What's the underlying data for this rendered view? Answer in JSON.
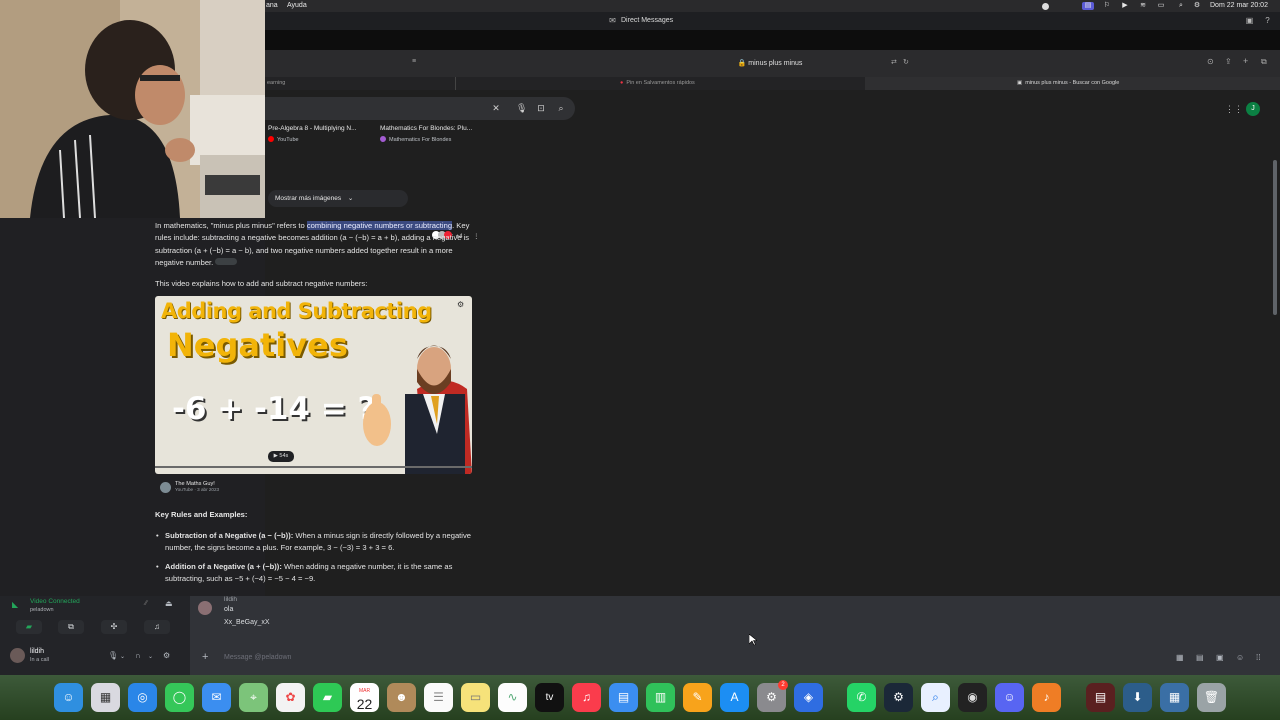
{
  "menubar": {
    "left_items": [
      "ana",
      "Ayuda"
    ],
    "datetime": "Dom 22 mar  20:02"
  },
  "discord": {
    "window_title": "Direct Messages",
    "voice": {
      "status": "Video Connected",
      "channel": "peladown"
    },
    "user": {
      "name": "lildih",
      "status": "In a call"
    },
    "messages": {
      "author": "lildih",
      "lines": [
        "ola",
        "Xx_BeGay_xX"
      ],
      "input_placeholder": "Message @peladown"
    }
  },
  "browser": {
    "url": "minus plus minus",
    "tabs": [
      "earning",
      "Pin en Salvamentos rápidos",
      "minus plus minus - Buscar con Google"
    ],
    "avatar_letter": "J",
    "video_cards": [
      {
        "title": "Pre-Algebra 8 - Multiplying N...",
        "source": "YouTube"
      },
      {
        "title": "Mathematics For Blondes: Plu...",
        "source": "Mathematics For Blondes"
      }
    ],
    "more_images": "Mostrar más imágenes",
    "source_count": "+4",
    "overview": {
      "p1_before": "In mathematics, \"minus plus minus\" refers to ",
      "p1_highlight": "combining negative numbers or subtracting",
      "p1_after": ". Key rules include: subtracting a negative becomes addition (a − (−b) = a + b), adding a negative is subtraction (a + (−b) = a − b), and two negative numbers added together result in a more negative number."
    },
    "video_intro": "This video explains how to add and subtract negative numbers:",
    "video": {
      "line1": "Adding and Subtracting",
      "line2": "Negatives",
      "equation": "-6 + -14 = ?",
      "duration": "▶ 54s",
      "channel": "The Maths Guy!",
      "channel_sub": "YouTube · 3 abr 2023"
    },
    "key_rules_heading": "Key Rules and Examples:",
    "bullets": [
      {
        "title": "Subtraction of a Negative (a − (−b)):",
        "text": " When a minus sign is directly followed by a negative number, the signs become a plus. For example, 3 − (−3) = 3 + 3 = 6."
      },
      {
        "title": "Addition of a Negative (a + (−b)):",
        "text": " When adding a negative number, it is the same as subtracting, such as −5 + (−4) = −5 − 4 = −9."
      }
    ]
  },
  "dock": {
    "calendar_month": "MAR",
    "calendar_day": "22",
    "settings_badge": "2"
  }
}
